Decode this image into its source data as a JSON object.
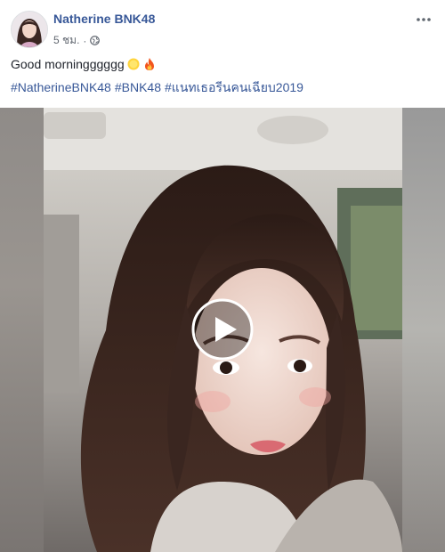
{
  "post": {
    "author": "Natherine BNK48",
    "time": "5 ชม.",
    "separator": "·",
    "privacy_icon": "globe-icon",
    "more_icon": "more-options-icon",
    "message": "Good morningggggg",
    "emojis": [
      "sun-emoji",
      "fire-emoji"
    ],
    "hashtags": [
      "#NatherineBNK48",
      "#BNK48",
      "#แนทเธอรีนคนเฉียบ2019"
    ]
  },
  "video": {
    "play_icon": "play-icon"
  },
  "colors": {
    "link": "#385898",
    "meta": "#616770",
    "text": "#1d2129"
  }
}
